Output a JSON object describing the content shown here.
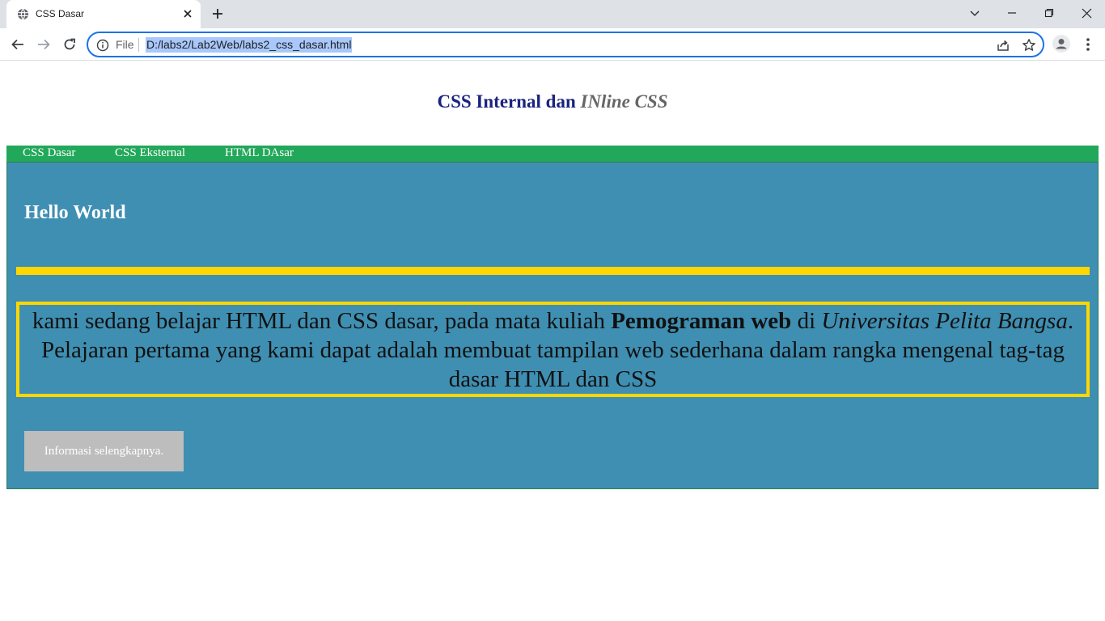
{
  "browser": {
    "tab_title": "CSS Dasar",
    "url_scheme": "File",
    "url": "D:/labs2/Lab2Web/labs2_css_dasar.html"
  },
  "page": {
    "heading_main": "CSS Internal dan ",
    "heading_italic": "INline CSS",
    "nav_items": [
      "CSS Dasar",
      "CSS Eksternal",
      "HTML DAsar"
    ],
    "hello": "Hello World",
    "paragraph": {
      "part1": "kami sedang belajar HTML dan CSS dasar, pada mata kuliah ",
      "bold": "Pemograman web",
      "part2": " di ",
      "italic": "Universitas Pelita Bangsa",
      "part3": ". Pelajaran pertama yang kami dapat adalah membuat tampilan web sederhana dalam rangka mengenal tag-tag dasar HTML dan CSS"
    },
    "button_label": "Informasi selengkapnya."
  },
  "colors": {
    "navbar": "#22a85a",
    "content_bg": "#3f8fb2",
    "accent_yellow": "#ffd700",
    "heading": "#1a237e",
    "button_bg": "#bdbdbd"
  }
}
